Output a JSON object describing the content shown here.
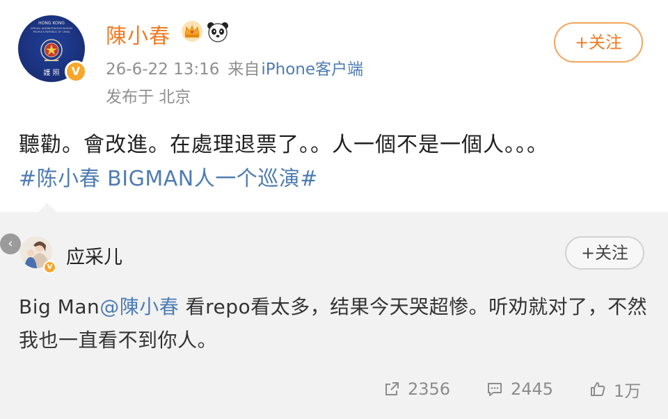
{
  "post": {
    "author": "陳小春",
    "timestamp": "26-6-22 13:16",
    "source_prefix": "来自",
    "source": "iPhone客户端",
    "location": "发布于 北京",
    "follow_label": "+关注",
    "text": "聽勸。會改進。在處理退票了。。人一個不是一個人。。。",
    "hashtag": "#陈小春 BIGMAN人一个巡演#",
    "icons": [
      "crown-icon",
      "panda-icon",
      "verified-badge-icon"
    ],
    "avatar_text": {
      "top": "HONG KONG",
      "line1": "SPECIAL ADMINISTRATIVE REGION",
      "line2": "PEOPLE'S REPUBLIC OF CHINA",
      "bottom": "護 照"
    }
  },
  "repost": {
    "author": "应采儿",
    "follow_label": "+关注",
    "text_prefix": "Big Man",
    "mention": "@陳小春",
    "text_suffix": " 看repo看太多，结果今天哭超惨。听劝就对了，不然我也一直看不到你人。"
  },
  "actions": {
    "share_count": "2356",
    "comment_count": "2445",
    "like_count": "1万"
  },
  "colors": {
    "accent": "#f07b22",
    "link": "#4e7cb3",
    "meta": "#8f8f8f",
    "repost_bg": "#f2f2f2"
  }
}
